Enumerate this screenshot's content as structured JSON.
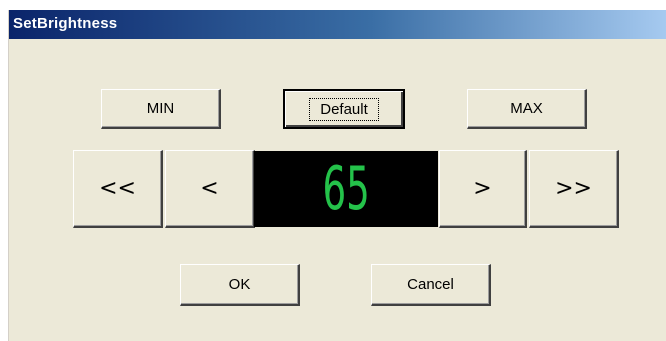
{
  "window": {
    "title": "SetBrightness"
  },
  "presets": {
    "min_label": "MIN",
    "default_label": "Default",
    "max_label": "MAX"
  },
  "stepper": {
    "fast_decrease_label": "<<",
    "decrease_label": "<",
    "value": "65",
    "increase_label": ">",
    "fast_increase_label": ">>"
  },
  "actions": {
    "ok_label": "OK",
    "cancel_label": "Cancel"
  },
  "colors": {
    "display_bg": "#000000",
    "display_digits": "#24c24a",
    "dialog_bg": "#ece9d8"
  }
}
